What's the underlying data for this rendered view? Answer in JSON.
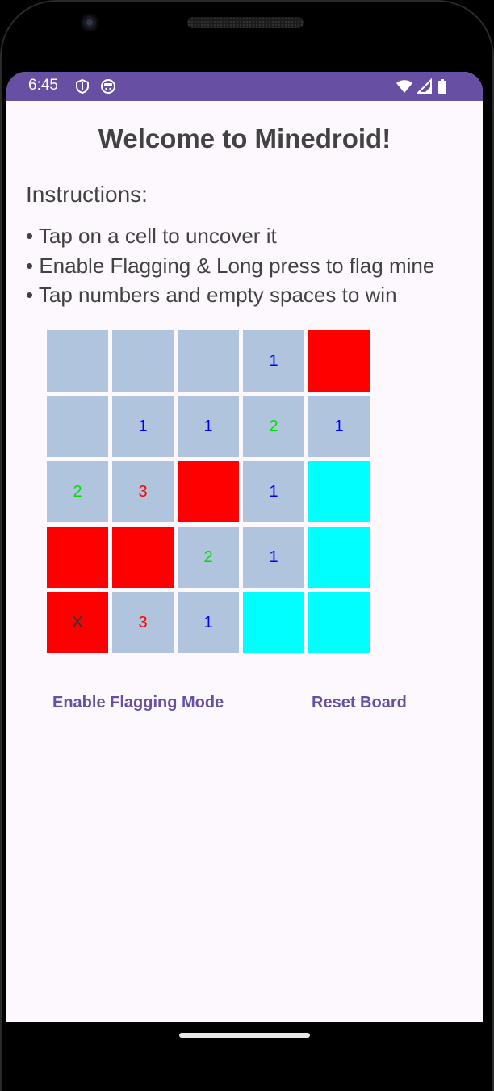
{
  "status_bar": {
    "time": "6:45",
    "left_icons": [
      "shield-icon",
      "android-face-icon"
    ],
    "right_icons": [
      "wifi-icon",
      "cellular-signal-icon",
      "battery-icon"
    ],
    "color": "#6750a4"
  },
  "app": {
    "title": "Welcome to Minedroid!",
    "instructions_heading": "Instructions:",
    "instructions": [
      "• Tap on a cell to uncover it",
      "• Enable Flagging & Long press to flag mine",
      "• Tap numbers and empty spaces to win"
    ]
  },
  "board": {
    "rows": [
      [
        {
          "label": "",
          "state": "uncovered"
        },
        {
          "label": "",
          "state": "uncovered"
        },
        {
          "label": "",
          "state": "uncovered"
        },
        {
          "label": "1",
          "state": "uncovered"
        },
        {
          "label": "",
          "state": "mine"
        }
      ],
      [
        {
          "label": "",
          "state": "uncovered"
        },
        {
          "label": "1",
          "state": "uncovered"
        },
        {
          "label": "1",
          "state": "uncovered"
        },
        {
          "label": "2",
          "state": "uncovered"
        },
        {
          "label": "1",
          "state": "uncovered"
        }
      ],
      [
        {
          "label": "2",
          "state": "uncovered"
        },
        {
          "label": "3",
          "state": "uncovered"
        },
        {
          "label": "",
          "state": "mine"
        },
        {
          "label": "1",
          "state": "uncovered"
        },
        {
          "label": "",
          "state": "covered"
        }
      ],
      [
        {
          "label": "",
          "state": "mine"
        },
        {
          "label": "",
          "state": "mine"
        },
        {
          "label": "2",
          "state": "uncovered"
        },
        {
          "label": "1",
          "state": "uncovered"
        },
        {
          "label": "",
          "state": "covered"
        }
      ],
      [
        {
          "label": "X",
          "state": "mine"
        },
        {
          "label": "3",
          "state": "uncovered"
        },
        {
          "label": "1",
          "state": "uncovered"
        },
        {
          "label": "",
          "state": "covered"
        },
        {
          "label": "",
          "state": "covered"
        }
      ]
    ],
    "state_colors": {
      "uncovered": "#b0c4de",
      "mine": "#ff0000",
      "covered": "#00ffff"
    },
    "number_colors": {
      "1": "#0000ff",
      "2": "#00e000",
      "3": "#ff0000",
      "X": "#333333"
    }
  },
  "buttons": {
    "flagging": "Enable Flagging Mode",
    "reset": "Reset Board"
  }
}
